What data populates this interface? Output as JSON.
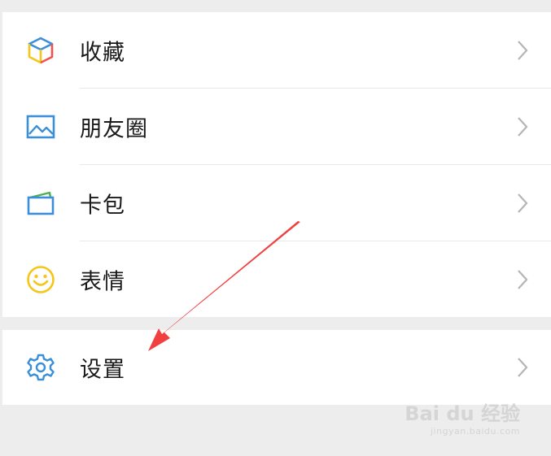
{
  "menu": {
    "items": [
      {
        "label": "收藏",
        "icon": "favorites-cube-icon"
      },
      {
        "label": "朋友圈",
        "icon": "moments-image-icon"
      },
      {
        "label": "卡包",
        "icon": "card-wallet-icon"
      },
      {
        "label": "表情",
        "icon": "smiley-emoji-icon"
      }
    ],
    "settings": {
      "label": "设置",
      "icon": "gear-icon"
    }
  },
  "watermark": {
    "text": "Bai du 经验",
    "sub": "jingyan.baidu.com"
  },
  "colors": {
    "background": "#ededed",
    "panel": "#ffffff",
    "arrow": "#f04040",
    "icon_blue": "#3b8fd9",
    "icon_yellow": "#f5c518"
  }
}
